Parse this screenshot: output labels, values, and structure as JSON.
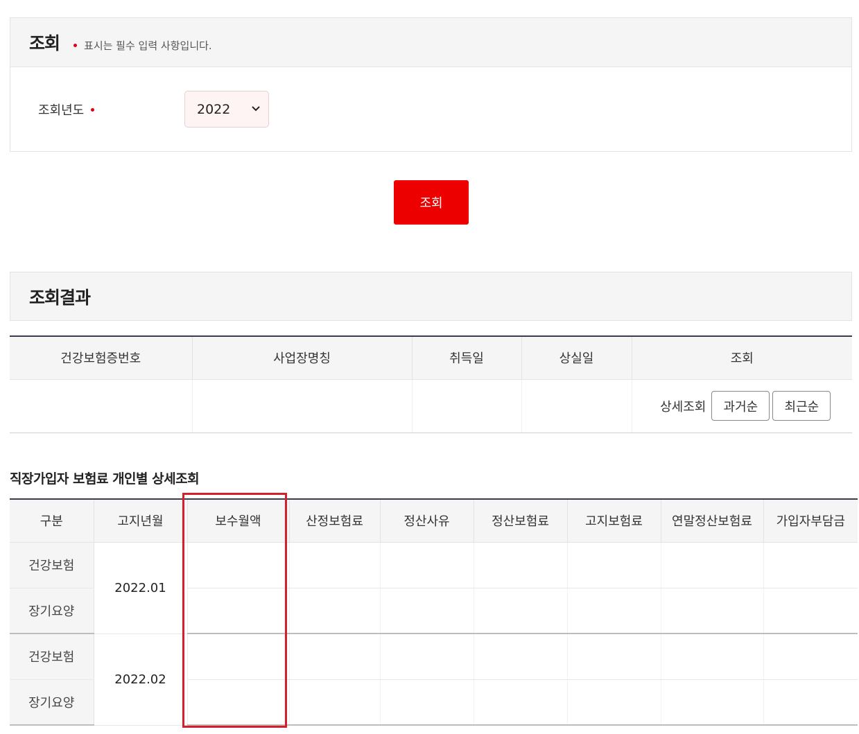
{
  "search": {
    "title": "조회",
    "required_note": "표시는 필수 입력 사항입니다.",
    "year_label": "조회년도",
    "year_value": "2022",
    "submit_label": "조회"
  },
  "result": {
    "title": "조회결과",
    "headers": [
      "건강보험증번호",
      "사업장명칭",
      "취득일",
      "상실일",
      "조회"
    ],
    "lookup_label": "상세조회",
    "btn_past": "과거순",
    "btn_recent": "최근순"
  },
  "detail": {
    "title": "직장가입자 보험료 개인별 상세조회",
    "headers": [
      "구분",
      "고지년월",
      "보수월액",
      "산정보험료",
      "정산사유",
      "정산보험료",
      "고지보험료",
      "연말정산보험료",
      "가입자부담금"
    ],
    "rows": [
      {
        "kind": "건강보험",
        "period": "2022.01"
      },
      {
        "kind": "장기요양",
        "period": ""
      },
      {
        "kind": "건강보험",
        "period": "2022.02"
      },
      {
        "kind": "장기요양",
        "period": ""
      }
    ]
  },
  "colors": {
    "accent_red": "#ec0000",
    "highlight": "#d4202a",
    "header_bg": "#f5f5f5"
  }
}
